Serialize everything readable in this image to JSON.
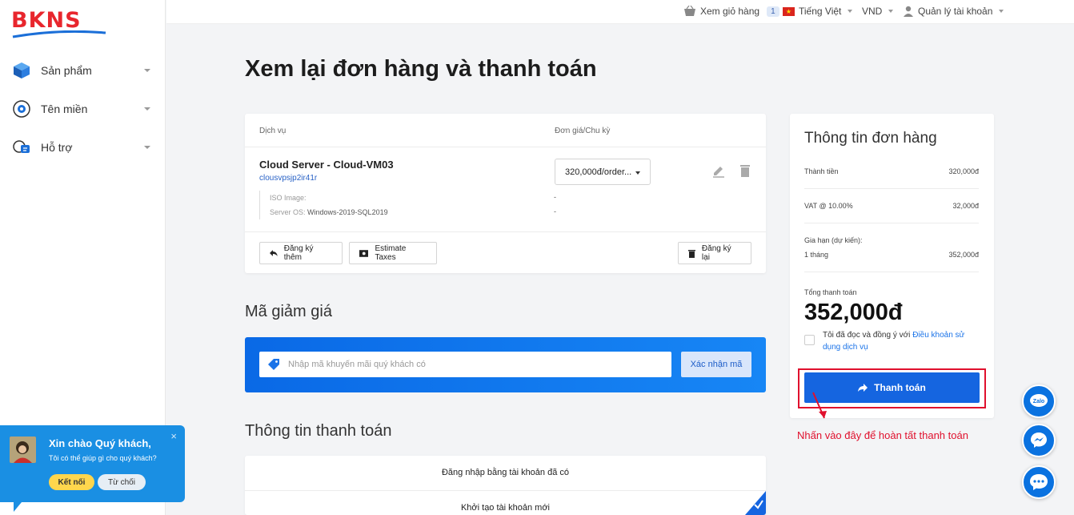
{
  "brand": {
    "logo_text": "BKNS"
  },
  "sidebar": {
    "items": [
      {
        "label": "Sản phẩm"
      },
      {
        "label": "Tên miền"
      },
      {
        "label": "Hỗ trợ"
      }
    ]
  },
  "topbar": {
    "cart_label": "Xem giỏ hàng",
    "cart_count": "1",
    "language": "Tiếng Việt",
    "currency": "VND",
    "account": "Quản lý tài khoản"
  },
  "page": {
    "title": "Xem lại đơn hàng và thanh toán"
  },
  "order": {
    "col_service": "Dịch vụ",
    "col_price": "Đơn giá/Chu kỳ",
    "product_name": "Cloud Server - Cloud-VM03",
    "hostname": "clousvpsjp2ir41r",
    "specs": [
      {
        "label": "ISO Image:",
        "value": "",
        "price": "-"
      },
      {
        "label": "Server OS:",
        "value": "Windows-2019-SQL2019",
        "price": "-"
      }
    ],
    "price_selected": "320,000đ/order...",
    "btn_add_more": "Đăng ký thêm",
    "btn_estimate": "Estimate Taxes",
    "btn_empty": "Đăng ký lại"
  },
  "promo": {
    "heading": "Mã giảm giá",
    "placeholder": "Nhập mã khuyến mãi quý khách có",
    "btn": "Xác nhận mã"
  },
  "payment_info": {
    "heading": "Thông tin thanh toán",
    "opt_login": "Đăng nhập bằng tài khoản đã có",
    "opt_new": "Khởi tạo tài khoản mới"
  },
  "summary": {
    "title": "Thông tin đơn hàng",
    "subtotal_label": "Thành tiền",
    "subtotal_value": "320,000đ",
    "vat_label": "VAT @ 10.00%",
    "vat_value": "32,000đ",
    "renew_label": "Gia hạn (dự kiến):",
    "renew_period": "1 tháng",
    "renew_value": "352,000đ",
    "total_label": "Tổng thanh toán",
    "total_value": "352,000đ",
    "agree_text": "Tôi đã đọc và đồng ý với ",
    "agree_link": "Điều khoản sử dụng dịch vụ",
    "pay_btn": "Thanh toán"
  },
  "annotation": "Nhấn vào đây để hoàn tất thanh toán",
  "chat": {
    "title": "Xin chào Quý khách,",
    "subtitle": "Tôi có thể giúp gì cho quý khách?",
    "btn_connect": "Kết nối",
    "btn_decline": "Từ chối",
    "close": "×"
  },
  "floating": {
    "zalo": "Zalo"
  }
}
